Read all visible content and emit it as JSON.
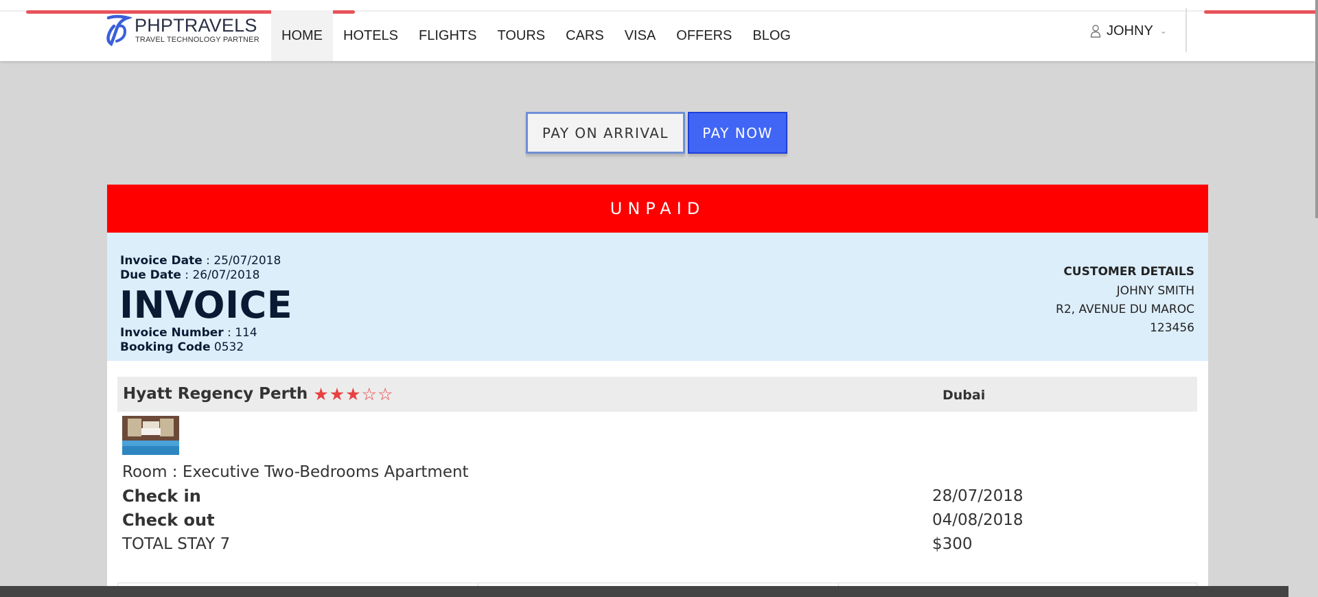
{
  "brand": {
    "name": "PHPTRAVELS",
    "tagline": "TRAVEL TECHNOLOGY PARTNER",
    "accent": "#e8535a",
    "logo_color": "#3a5fd9"
  },
  "nav": {
    "items": [
      {
        "label": "HOME",
        "active": true
      },
      {
        "label": "HOTELS"
      },
      {
        "label": "FLIGHTS"
      },
      {
        "label": "TOURS"
      },
      {
        "label": "CARS"
      },
      {
        "label": "VISA"
      },
      {
        "label": "OFFERS"
      },
      {
        "label": "BLOG"
      }
    ],
    "user": {
      "name": "JOHNY",
      "icon": "user-icon"
    }
  },
  "payment": {
    "pay_on_arrival_label": "PAY ON ARRIVAL",
    "pay_now_label": "PAY NOW",
    "pay_now_color": "#4166f5"
  },
  "invoice": {
    "status": "UNPAID",
    "status_color": "#fe0000",
    "invoice_date_label": "Invoice Date",
    "invoice_date": "25/07/2018",
    "due_date_label": "Due Date",
    "due_date": "26/07/2018",
    "title": "INVOICE",
    "invoice_number_label": "Invoice Number",
    "invoice_number": "114",
    "booking_code_label": "Booking Code",
    "booking_code": "0532",
    "customer": {
      "title": "CUSTOMER DETAILS",
      "name": "JOHNY SMITH",
      "address": "R2, AVENUE DU MAROC",
      "phone": "123456"
    }
  },
  "hotel": {
    "name": "Hyatt Regency Perth",
    "rating": 3,
    "max_rating": 5,
    "city": "Dubai",
    "room_label": "Room",
    "room": "Executive Two-Bedrooms Apartment",
    "check_in_label": "Check in",
    "check_in": "28/07/2018",
    "check_out_label": "Check out",
    "check_out": "04/08/2018",
    "total_stay_label": "TOTAL STAY 7",
    "total_price": "$300"
  }
}
